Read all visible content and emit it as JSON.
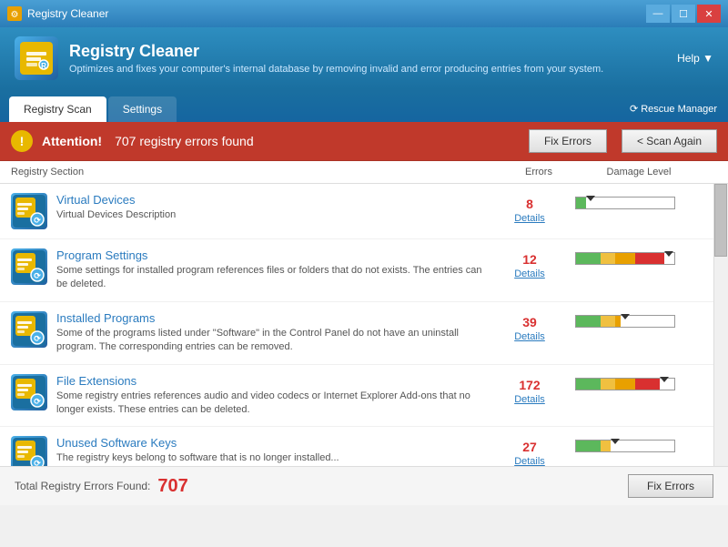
{
  "titleBar": {
    "title": "Registry Cleaner",
    "icon": "⚙",
    "minimize": "—",
    "maximize": "☐",
    "close": "✕"
  },
  "header": {
    "title": "Registry Cleaner",
    "description": "Optimizes and fixes your computer's internal database by removing invalid and error producing entries from your system.",
    "helpLabel": "Help ▼"
  },
  "tabs": {
    "items": [
      {
        "label": "Registry Scan",
        "active": true
      },
      {
        "label": "Settings",
        "active": false
      }
    ],
    "rescueManager": "⟳ Rescue Manager"
  },
  "attention": {
    "icon": "!",
    "boldText": "Attention!",
    "message": " 707 registry errors found",
    "fixErrors": "Fix Errors",
    "scanAgain": "< Scan Again"
  },
  "columns": {
    "section": "Registry Section",
    "errors": "Errors",
    "damage": "Damage Level"
  },
  "items": [
    {
      "title": "Virtual Devices",
      "description": "Virtual Devices Description",
      "errors": "8",
      "detailsLabel": "Details",
      "damagePercent": 10,
      "damageType": "low"
    },
    {
      "title": "Program Settings",
      "description": "Some settings for installed program references files or folders that do not exists. The entries can be deleted.",
      "errors": "12",
      "detailsLabel": "Details",
      "damagePercent": 90,
      "damageType": "high"
    },
    {
      "title": "Installed Programs",
      "description": "Some of the programs listed under \"Software\" in the Control Panel do not have an uninstall program. The corresponding entries can be removed.",
      "errors": "39",
      "detailsLabel": "Details",
      "damagePercent": 45,
      "damageType": "medium"
    },
    {
      "title": "File Extensions",
      "description": "Some registry entries references audio and video codecs or Internet Explorer Add-ons that no longer exists. These entries can be deleted.",
      "errors": "172",
      "detailsLabel": "Details",
      "damagePercent": 85,
      "damageType": "high"
    },
    {
      "title": "Unused Software Keys",
      "description": "The registry keys belong to software that is no longer installed...",
      "errors": "27",
      "detailsLabel": "Details",
      "damagePercent": 35,
      "damageType": "medium-low"
    }
  ],
  "footer": {
    "label": "Total Registry Errors Found:",
    "count": "707",
    "fixErrors": "Fix Errors"
  },
  "colors": {
    "accent": "#2a7bbf",
    "error": "#d93030",
    "headerBg": "#1a6fa0",
    "attentionBg": "#c0392b"
  }
}
